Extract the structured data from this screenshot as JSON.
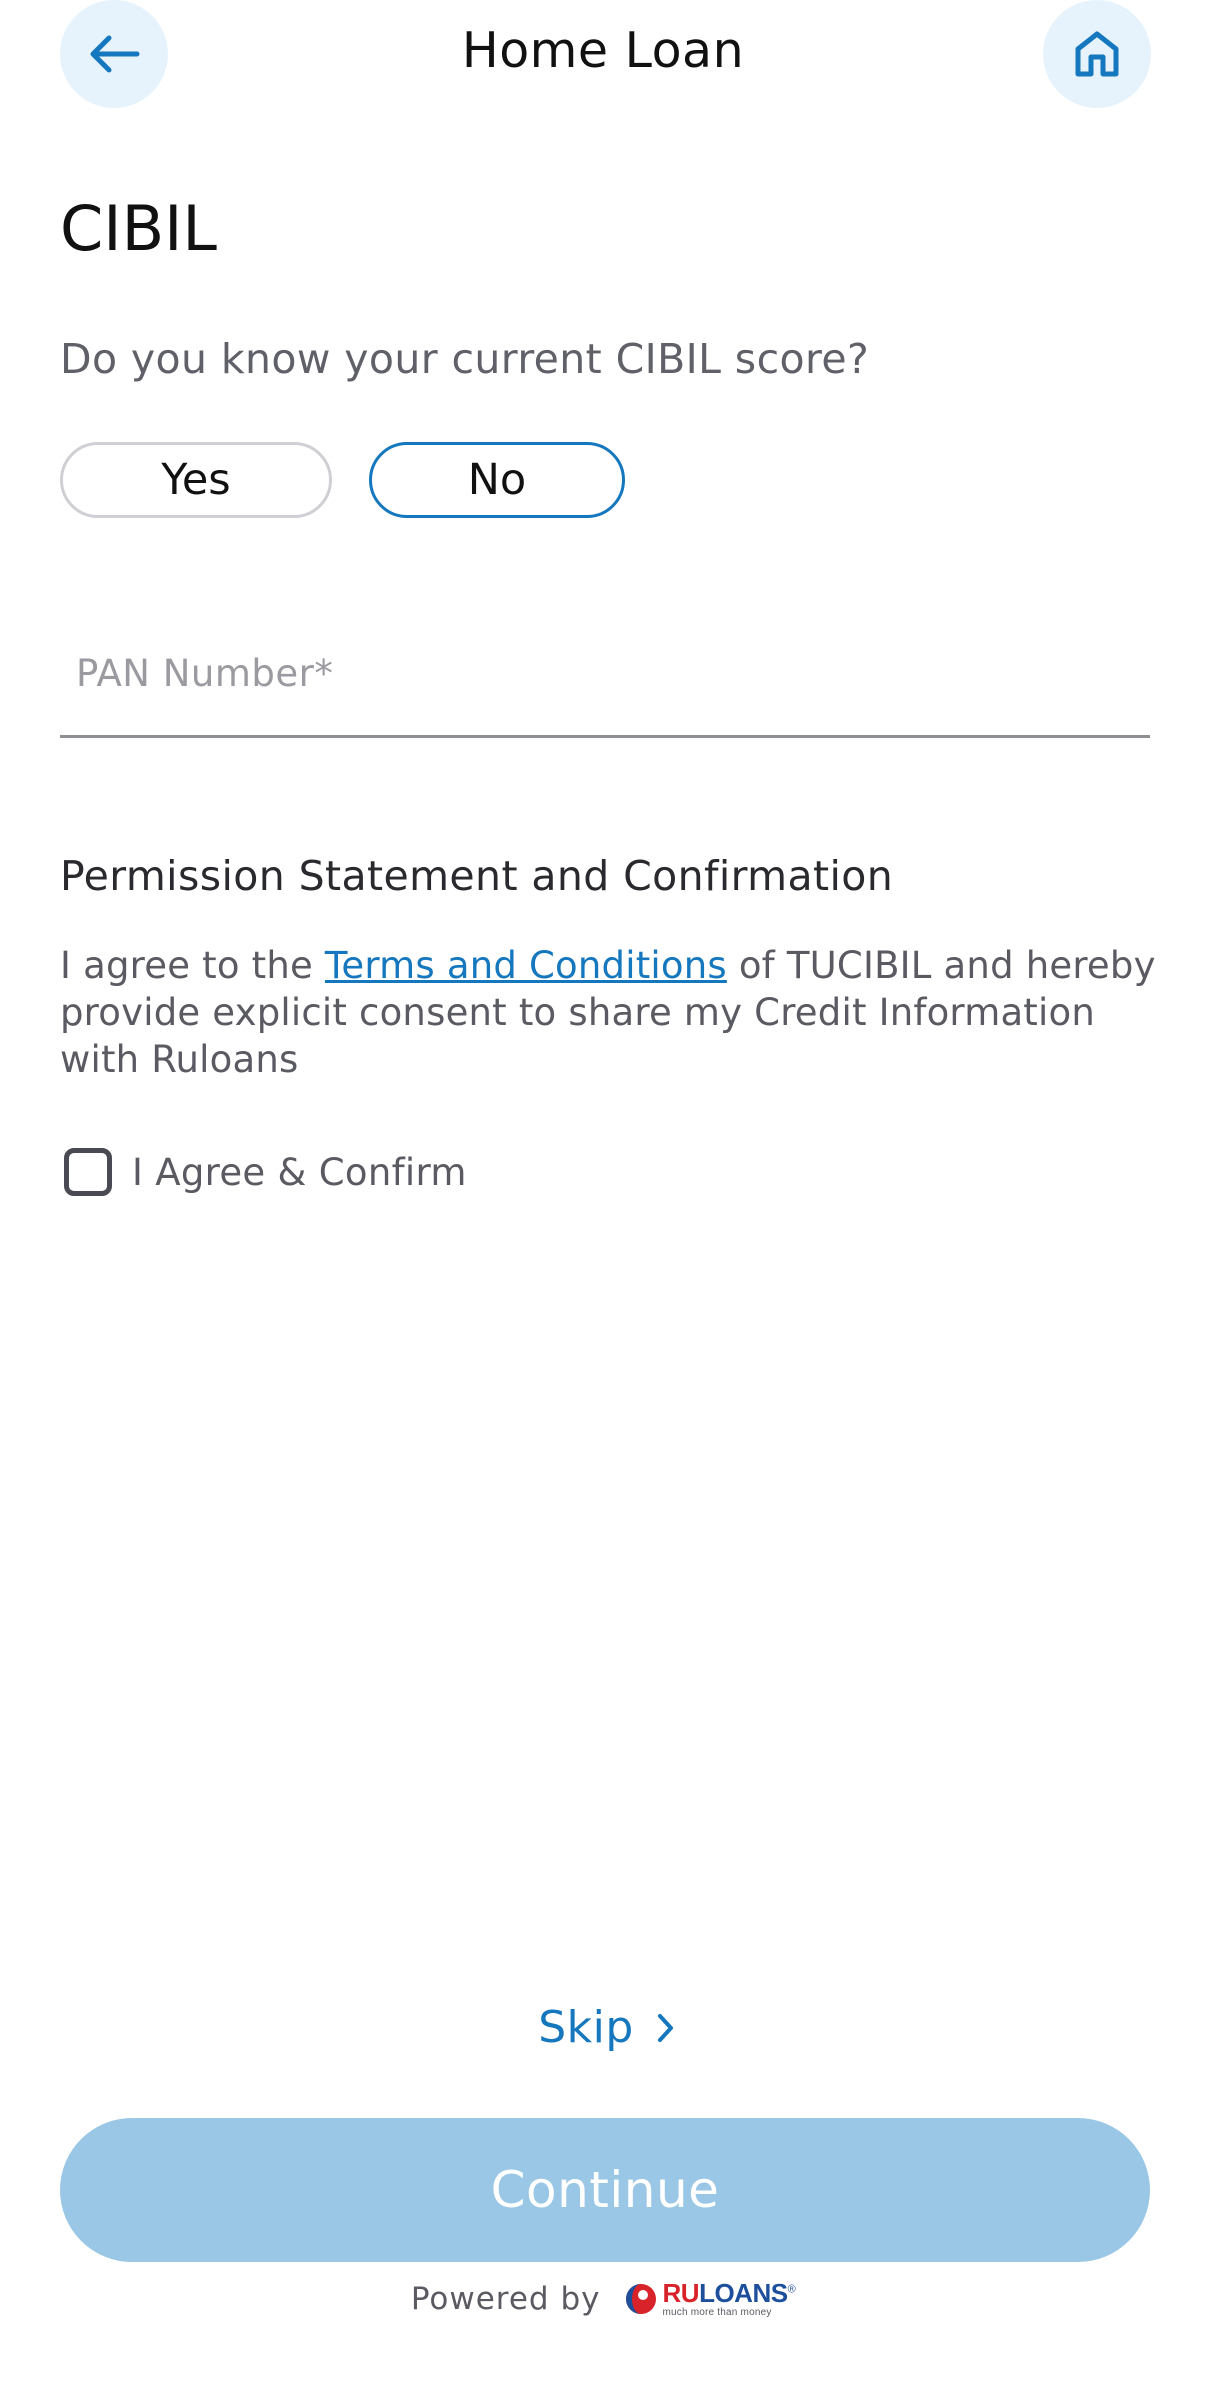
{
  "header": {
    "title": "Home Loan",
    "back_icon": "arrow-left-icon",
    "home_icon": "home-icon"
  },
  "page": {
    "title": "CIBIL",
    "question": "Do you know your current CIBIL score?",
    "options": [
      {
        "label": "Yes",
        "selected": false
      },
      {
        "label": "No",
        "selected": true
      }
    ]
  },
  "form": {
    "pan_placeholder": "PAN Number*",
    "pan_value": ""
  },
  "permission": {
    "heading": "Permission Statement and Confirmation",
    "text_before": "I agree to the ",
    "link_text": "Terms and Conditions",
    "text_after": " of TUCIBIL and hereby provide explicit consent to share my Credit Information with Ruloans",
    "agree_label": "I Agree & Confirm",
    "agree_checked": false
  },
  "actions": {
    "skip_label": "Skip",
    "continue_label": "Continue"
  },
  "footer": {
    "powered_by": "Powered by",
    "logo_name_red": "RU",
    "logo_name_blue": "LOANS",
    "logo_reg": "®",
    "logo_tagline": "much more than money"
  },
  "colors": {
    "accent": "#1577bd",
    "button_disabled": "#9ac7e6",
    "icon_circle_bg": "#e6f3fc",
    "logo_red": "#d8232a",
    "logo_blue": "#1d4f9c"
  }
}
